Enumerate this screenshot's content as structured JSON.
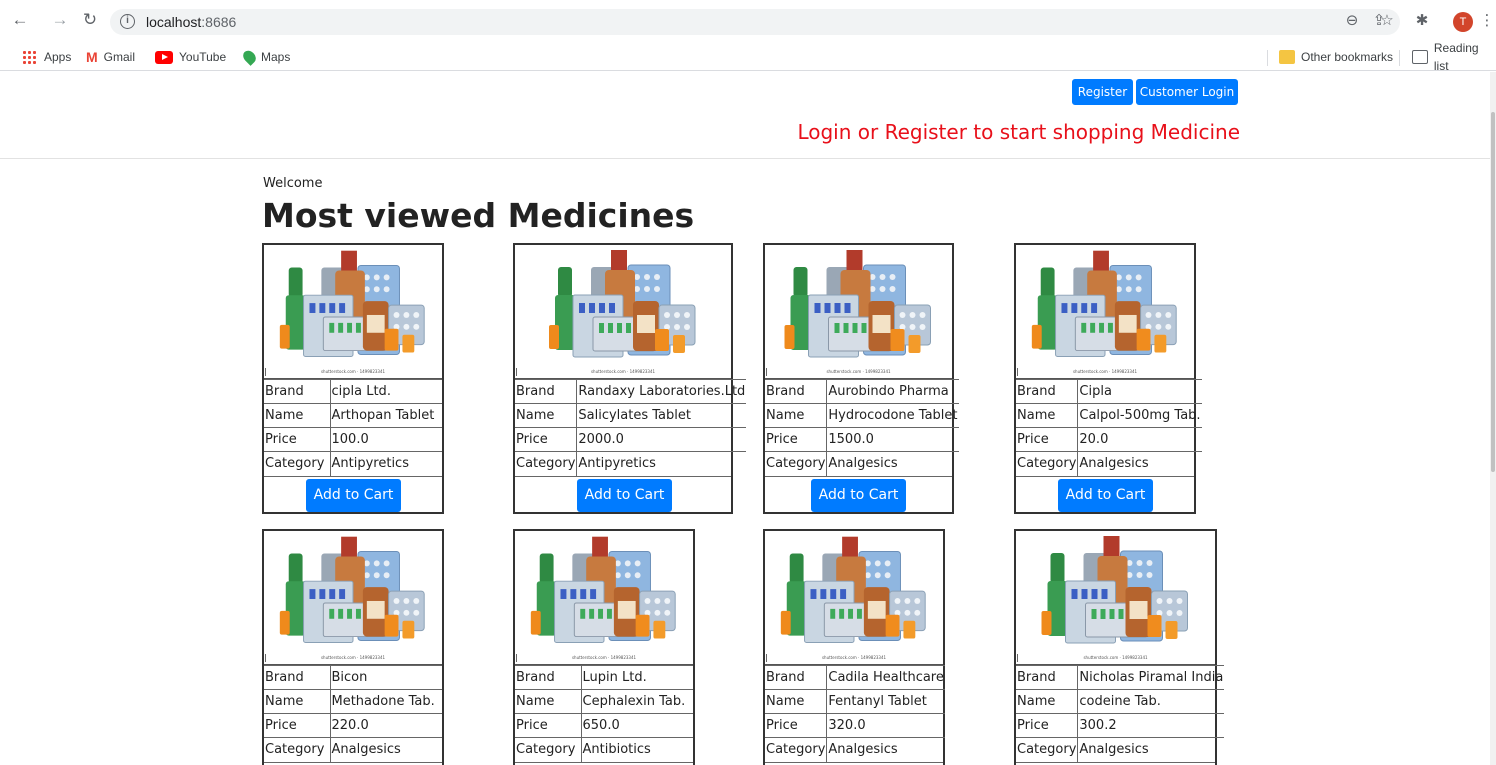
{
  "browser": {
    "url_host": "localhost",
    "url_port": ":8686",
    "profile_initial": "T",
    "bookmarks": [
      "Apps",
      "Gmail",
      "YouTube",
      "Maps"
    ],
    "other_bookmarks": "Other bookmarks",
    "reading_list": "Reading list"
  },
  "header": {
    "register_label": "Register",
    "login_label": "Customer Login",
    "banner": "Login or Register to start shopping Medicine"
  },
  "main": {
    "welcome": "Welcome",
    "title": "Most viewed Medicines"
  },
  "labels": {
    "brand": "Brand",
    "name": "Name",
    "price": "Price",
    "category": "Category",
    "add_to_cart": "Add to Cart"
  },
  "image_watermark": "shutterstock.com · 1499823341",
  "medicines": [
    {
      "brand": "cipla Ltd.",
      "name": "Arthopan Tablet",
      "price": "100.0",
      "category": "Antipyretics"
    },
    {
      "brand": "Randaxy Laboratories.Ltd",
      "name": "Salicylates Tablet",
      "price": "2000.0",
      "category": "Antipyretics"
    },
    {
      "brand": "Aurobindo Pharma",
      "name": "Hydrocodone Tablet",
      "price": "1500.0",
      "category": "Analgesics"
    },
    {
      "brand": "Cipla",
      "name": "Calpol-500mg Tab.",
      "price": "20.0",
      "category": "Analgesics"
    },
    {
      "brand": "Bicon",
      "name": "Methadone Tab.",
      "price": "220.0",
      "category": "Analgesics"
    },
    {
      "brand": "Lupin Ltd.",
      "name": "Cephalexin Tab.",
      "price": "650.0",
      "category": "Antibiotics"
    },
    {
      "brand": "Cadila Healthcare",
      "name": "Fentanyl Tablet",
      "price": "320.0",
      "category": "Analgesics"
    },
    {
      "brand": "Nicholas Piramal India",
      "name": "codeine Tab.",
      "price": "300.2",
      "category": "Analgesics"
    }
  ]
}
